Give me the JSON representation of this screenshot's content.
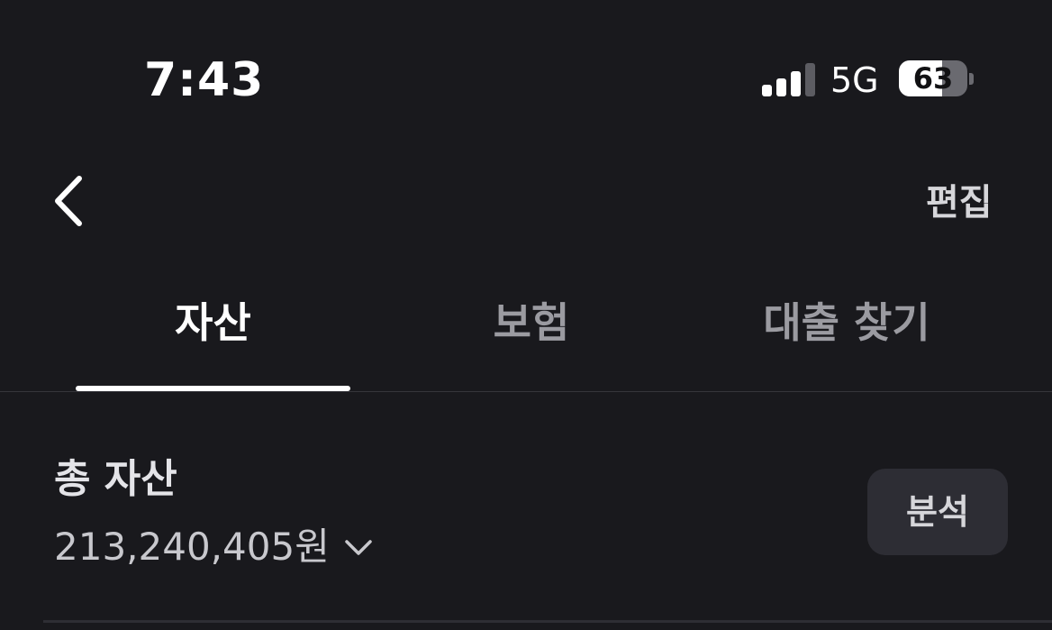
{
  "status_bar": {
    "time": "7:43",
    "network": "5G",
    "signal_bars_active": 3,
    "signal_bars_total": 4,
    "battery_percent": 63,
    "battery_label": "63"
  },
  "nav": {
    "back_icon": "chevron-left-icon",
    "edit_label": "편집"
  },
  "tabs": [
    {
      "label": "자산",
      "active": true
    },
    {
      "label": "보험",
      "active": false
    },
    {
      "label": "대출 찾기",
      "active": false
    }
  ],
  "summary": {
    "title": "총 자산",
    "amount": "213,240,405원",
    "amount_icon": "chevron-down-icon",
    "analysis_label": "분석"
  },
  "colors": {
    "background": "#19191d",
    "button_bg": "#2d2d34",
    "active_tab": "#ffffff",
    "inactive_tab": "#9b9ba1"
  }
}
